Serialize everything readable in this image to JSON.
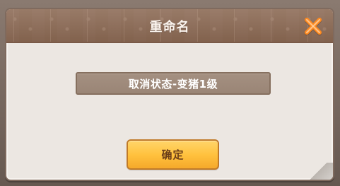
{
  "dialog": {
    "title": "重命名",
    "status_text": "取消状态-变猪1级",
    "confirm_label": "确定",
    "close_icon": "close-icon"
  },
  "colors": {
    "title_bar": "#8c6a55",
    "dialog_bg": "#ece7e2",
    "status_bg": "#a49081",
    "button_bg": "#ffc13d",
    "close_orange": "#ff8a1f"
  }
}
